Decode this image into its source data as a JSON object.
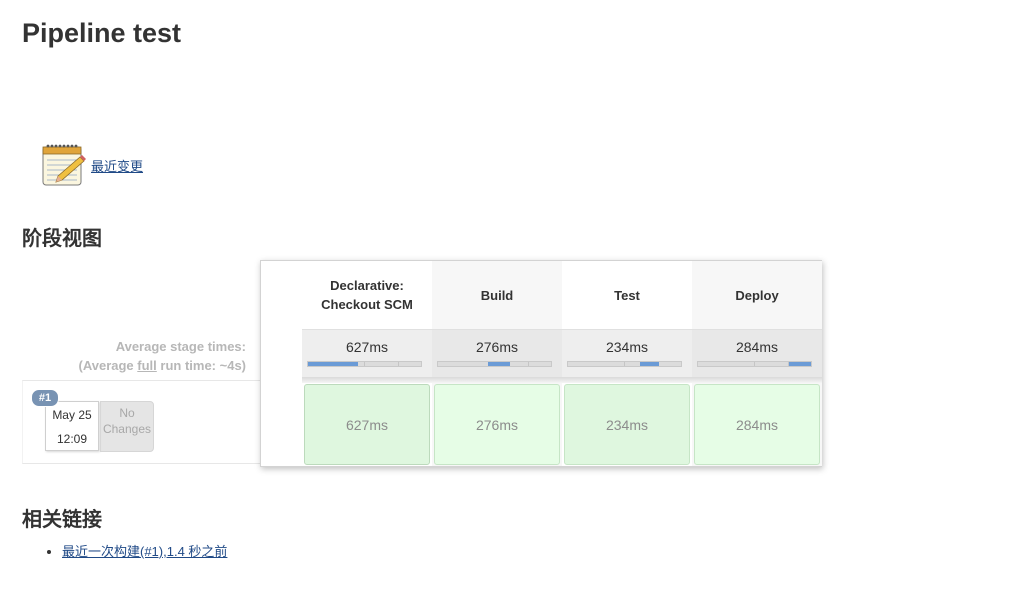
{
  "page": {
    "title": "Pipeline test"
  },
  "changes": {
    "link_text": "最近变更",
    "icon": "notepad-icon"
  },
  "stage_view": {
    "section_title": "阶段视图",
    "average_label_line1": "Average stage times:",
    "average_label_line2_prefix": "(Average ",
    "average_label_line2_link": "full",
    "average_label_line2_suffix": " run time: ~4s)",
    "bar_color": "#6b9bd6",
    "success_cell_color": "#dff7df",
    "stages": [
      {
        "name": "Declarative: Checkout SCM",
        "avg_time": "627ms",
        "bar_fraction": 0.46,
        "cell_time": "627ms"
      },
      {
        "name": "Build",
        "avg_time": "276ms",
        "bar_fraction": 0.2,
        "cell_time": "276ms"
      },
      {
        "name": "Test",
        "avg_time": "234ms",
        "bar_fraction": 0.17,
        "cell_time": "234ms"
      },
      {
        "name": "Deploy",
        "avg_time": "284ms",
        "bar_fraction": 0.2,
        "cell_time": "284ms"
      }
    ],
    "runs": [
      {
        "badge": "#1",
        "date": "May 25",
        "time": "12:09",
        "changes": "No Changes"
      }
    ]
  },
  "related_links": {
    "section_title": "相关链接",
    "items": [
      {
        "label": "最近一次构建(#1),1.4 秒之前"
      }
    ]
  }
}
